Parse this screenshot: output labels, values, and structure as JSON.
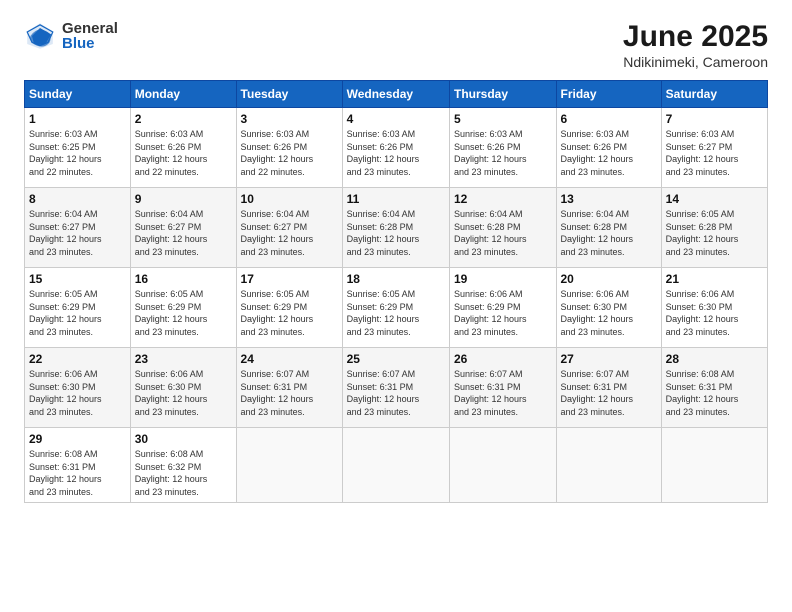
{
  "logo": {
    "general": "General",
    "blue": "Blue"
  },
  "title": "June 2025",
  "subtitle": "Ndikinimeki, Cameroon",
  "weekdays": [
    "Sunday",
    "Monday",
    "Tuesday",
    "Wednesday",
    "Thursday",
    "Friday",
    "Saturday"
  ],
  "weeks": [
    [
      {
        "day": "1",
        "info": "Sunrise: 6:03 AM\nSunset: 6:25 PM\nDaylight: 12 hours\nand 22 minutes."
      },
      {
        "day": "2",
        "info": "Sunrise: 6:03 AM\nSunset: 6:26 PM\nDaylight: 12 hours\nand 22 minutes."
      },
      {
        "day": "3",
        "info": "Sunrise: 6:03 AM\nSunset: 6:26 PM\nDaylight: 12 hours\nand 22 minutes."
      },
      {
        "day": "4",
        "info": "Sunrise: 6:03 AM\nSunset: 6:26 PM\nDaylight: 12 hours\nand 23 minutes."
      },
      {
        "day": "5",
        "info": "Sunrise: 6:03 AM\nSunset: 6:26 PM\nDaylight: 12 hours\nand 23 minutes."
      },
      {
        "day": "6",
        "info": "Sunrise: 6:03 AM\nSunset: 6:26 PM\nDaylight: 12 hours\nand 23 minutes."
      },
      {
        "day": "7",
        "info": "Sunrise: 6:03 AM\nSunset: 6:27 PM\nDaylight: 12 hours\nand 23 minutes."
      }
    ],
    [
      {
        "day": "8",
        "info": "Sunrise: 6:04 AM\nSunset: 6:27 PM\nDaylight: 12 hours\nand 23 minutes."
      },
      {
        "day": "9",
        "info": "Sunrise: 6:04 AM\nSunset: 6:27 PM\nDaylight: 12 hours\nand 23 minutes."
      },
      {
        "day": "10",
        "info": "Sunrise: 6:04 AM\nSunset: 6:27 PM\nDaylight: 12 hours\nand 23 minutes."
      },
      {
        "day": "11",
        "info": "Sunrise: 6:04 AM\nSunset: 6:28 PM\nDaylight: 12 hours\nand 23 minutes."
      },
      {
        "day": "12",
        "info": "Sunrise: 6:04 AM\nSunset: 6:28 PM\nDaylight: 12 hours\nand 23 minutes."
      },
      {
        "day": "13",
        "info": "Sunrise: 6:04 AM\nSunset: 6:28 PM\nDaylight: 12 hours\nand 23 minutes."
      },
      {
        "day": "14",
        "info": "Sunrise: 6:05 AM\nSunset: 6:28 PM\nDaylight: 12 hours\nand 23 minutes."
      }
    ],
    [
      {
        "day": "15",
        "info": "Sunrise: 6:05 AM\nSunset: 6:29 PM\nDaylight: 12 hours\nand 23 minutes."
      },
      {
        "day": "16",
        "info": "Sunrise: 6:05 AM\nSunset: 6:29 PM\nDaylight: 12 hours\nand 23 minutes."
      },
      {
        "day": "17",
        "info": "Sunrise: 6:05 AM\nSunset: 6:29 PM\nDaylight: 12 hours\nand 23 minutes."
      },
      {
        "day": "18",
        "info": "Sunrise: 6:05 AM\nSunset: 6:29 PM\nDaylight: 12 hours\nand 23 minutes."
      },
      {
        "day": "19",
        "info": "Sunrise: 6:06 AM\nSunset: 6:29 PM\nDaylight: 12 hours\nand 23 minutes."
      },
      {
        "day": "20",
        "info": "Sunrise: 6:06 AM\nSunset: 6:30 PM\nDaylight: 12 hours\nand 23 minutes."
      },
      {
        "day": "21",
        "info": "Sunrise: 6:06 AM\nSunset: 6:30 PM\nDaylight: 12 hours\nand 23 minutes."
      }
    ],
    [
      {
        "day": "22",
        "info": "Sunrise: 6:06 AM\nSunset: 6:30 PM\nDaylight: 12 hours\nand 23 minutes."
      },
      {
        "day": "23",
        "info": "Sunrise: 6:06 AM\nSunset: 6:30 PM\nDaylight: 12 hours\nand 23 minutes."
      },
      {
        "day": "24",
        "info": "Sunrise: 6:07 AM\nSunset: 6:31 PM\nDaylight: 12 hours\nand 23 minutes."
      },
      {
        "day": "25",
        "info": "Sunrise: 6:07 AM\nSunset: 6:31 PM\nDaylight: 12 hours\nand 23 minutes."
      },
      {
        "day": "26",
        "info": "Sunrise: 6:07 AM\nSunset: 6:31 PM\nDaylight: 12 hours\nand 23 minutes."
      },
      {
        "day": "27",
        "info": "Sunrise: 6:07 AM\nSunset: 6:31 PM\nDaylight: 12 hours\nand 23 minutes."
      },
      {
        "day": "28",
        "info": "Sunrise: 6:08 AM\nSunset: 6:31 PM\nDaylight: 12 hours\nand 23 minutes."
      }
    ],
    [
      {
        "day": "29",
        "info": "Sunrise: 6:08 AM\nSunset: 6:31 PM\nDaylight: 12 hours\nand 23 minutes."
      },
      {
        "day": "30",
        "info": "Sunrise: 6:08 AM\nSunset: 6:32 PM\nDaylight: 12 hours\nand 23 minutes."
      },
      {
        "day": "",
        "info": ""
      },
      {
        "day": "",
        "info": ""
      },
      {
        "day": "",
        "info": ""
      },
      {
        "day": "",
        "info": ""
      },
      {
        "day": "",
        "info": ""
      }
    ]
  ]
}
